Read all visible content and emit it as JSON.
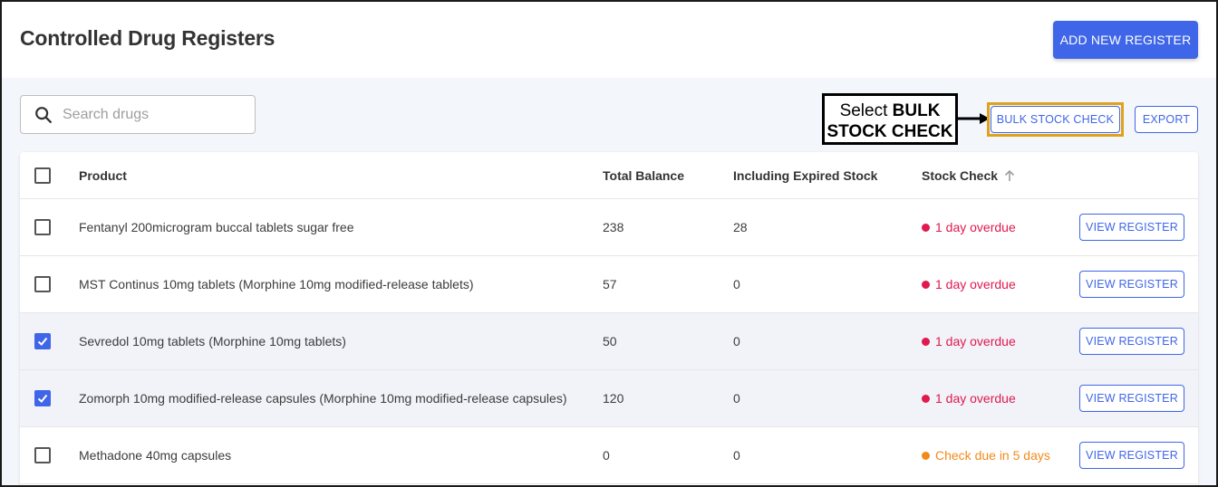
{
  "header": {
    "title": "Controlled Drug Registers",
    "add_button": "ADD NEW REGISTER"
  },
  "toolbar": {
    "search_placeholder": "Search drugs",
    "bulk_button": "BULK STOCK CHECK",
    "export_button": "EXPORT"
  },
  "callout": {
    "prefix": "Select ",
    "bold_line1": "BULK",
    "bold_line2": "STOCK CHECK"
  },
  "table": {
    "columns": {
      "product": "Product",
      "total_balance": "Total Balance",
      "including_expired": "Including Expired Stock",
      "stock_check": "Stock Check"
    },
    "view_label": "VIEW REGISTER",
    "rows": [
      {
        "product": "Fentanyl 200microgram buccal tablets sugar free",
        "balance": "238",
        "expired": "28",
        "status": "1 day overdue",
        "status_type": "overdue",
        "checked": false
      },
      {
        "product": "MST Continus 10mg tablets (Morphine 10mg modified-release tablets)",
        "balance": "57",
        "expired": "0",
        "status": "1 day overdue",
        "status_type": "overdue",
        "checked": false
      },
      {
        "product": "Sevredol 10mg tablets (Morphine 10mg tablets)",
        "balance": "50",
        "expired": "0",
        "status": "1 day overdue",
        "status_type": "overdue",
        "checked": true
      },
      {
        "product": "Zomorph 10mg modified-release capsules (Morphine 10mg modified-release capsules)",
        "balance": "120",
        "expired": "0",
        "status": "1 day overdue",
        "status_type": "overdue",
        "checked": true
      },
      {
        "product": "Methadone 40mg capsules",
        "balance": "0",
        "expired": "0",
        "status": "Check due in 5 days",
        "status_type": "due",
        "checked": false
      }
    ]
  },
  "colors": {
    "primary": "#3f66e8",
    "overdue": "#e0194f",
    "due_soon": "#f28a1a",
    "highlight_border": "#e0a21a",
    "content_bg": "#f3f6fb"
  }
}
